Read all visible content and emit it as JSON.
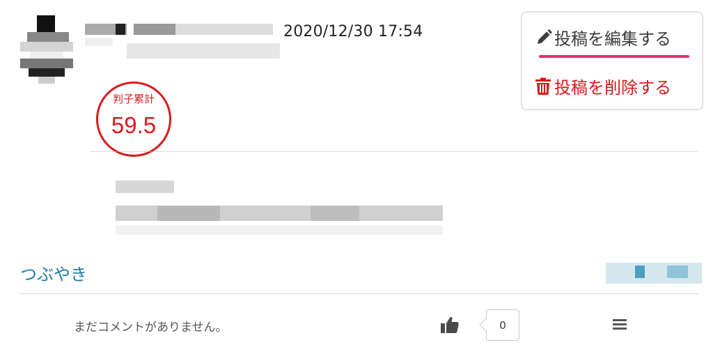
{
  "post": {
    "date": "2020/12/30 17:54",
    "stamp": {
      "label": "判子累計",
      "value": "59.5"
    }
  },
  "menu": {
    "edit_label": "投稿を編集する",
    "delete_label": "投稿を削除する",
    "edit_icon": "pencil-icon",
    "delete_icon": "trash-icon"
  },
  "section": {
    "label": "つぶやき"
  },
  "comments": {
    "empty_text": "まだコメントがありません。",
    "like_count": "0",
    "like_icon": "thumbs-up-icon",
    "menu_icon": "hamburger-icon"
  },
  "colors": {
    "stamp_red": "#d9191d",
    "delete_red": "#d9191d",
    "underline_pink": "#ea2d6c",
    "link_blue": "#1d7aa5"
  }
}
